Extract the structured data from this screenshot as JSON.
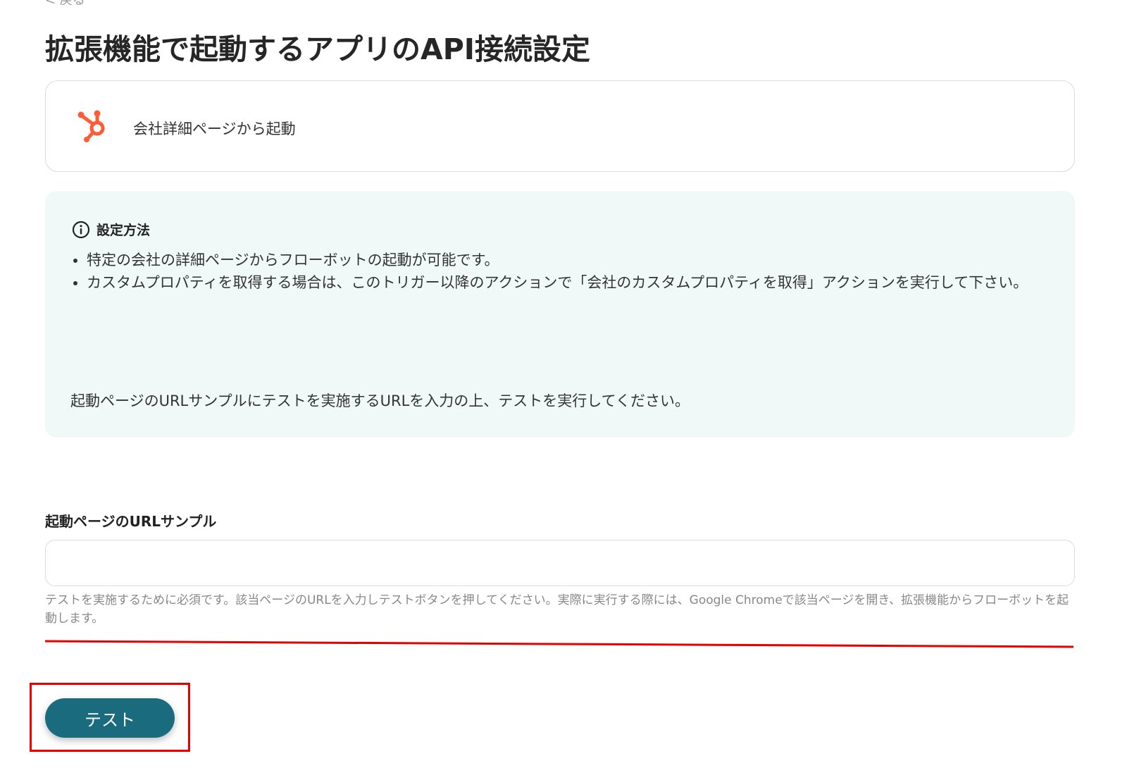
{
  "header": {
    "back_label": "< 戻る",
    "title": "拡張機能で起動するアプリのAPI接続設定"
  },
  "trigger": {
    "label": "会社詳細ページから起動",
    "icon": "hubspot-icon",
    "icon_color": "#ff5c35"
  },
  "info": {
    "title": "設定方法",
    "icon": "info-circle-icon",
    "items": [
      "特定の会社の詳細ページからフローボットの起動が可能です。",
      "カスタムプロパティを取得する場合は、このトリガー以降のアクションで「会社のカスタムプロパティを取得」アクションを実行して下さい。"
    ],
    "note": "起動ページのURLサンプルにテストを実施するURLを入力の上、テストを実行してください。",
    "background": "#f1f9f8"
  },
  "url_field": {
    "label": "起動ページのURLサンプル",
    "value": "",
    "placeholder": "",
    "help": "テストを実施するために必須です。該当ページのURLを入力しテストボタンを押してください。実際に実行する際には、Google Chromeで該当ページを開き、拡張機能からフローボットを起動します。"
  },
  "actions": {
    "test_label": "テスト",
    "button_color": "#1b6b7e"
  },
  "annotations": {
    "highlight_color": "#e60000"
  }
}
